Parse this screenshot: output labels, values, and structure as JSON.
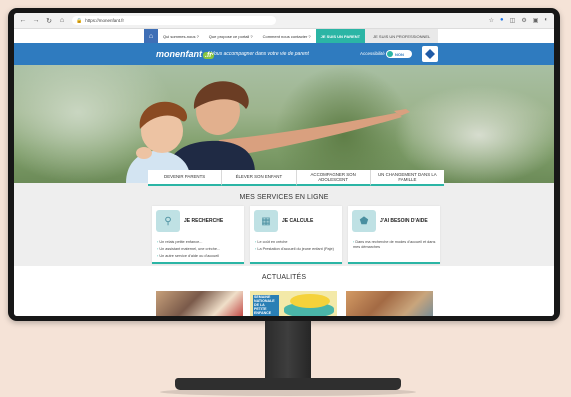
{
  "browser": {
    "url": "https://monenfant.fr"
  },
  "topnav": {
    "links": [
      "Qui sommes-nous ?",
      "Que propose ce portail ?",
      "Comment nous contacter ?"
    ],
    "parent_label": "JE SUIS UN PARENT",
    "pro_label": "JE SUIS UN PROFESSIONNEL"
  },
  "header": {
    "logo_main": "monenfant",
    "logo_suffix": ".fr",
    "tagline": "Vous accompagner dans votre vie de parent",
    "accessibility_label": "Accessibilité",
    "accessibility_toggle": "NON"
  },
  "hero_tabs": [
    "DEVENIR PARENTS",
    "ÉLEVER SON ENFANT",
    "ACCOMPAGNER SON ADOLESCENT",
    "UN CHANGEMENT DANS LA FAMILLE"
  ],
  "services": {
    "title": "MES SERVICES EN LIGNE",
    "cards": [
      {
        "title": "JE RECHERCHE",
        "items": [
          "Un relais petite enfance...",
          "Un assistant maternel, une crèche...",
          "Un autre service d'aide ou d'accueil"
        ]
      },
      {
        "title": "JE CALCULE",
        "items": [
          "Le coût en crèche",
          "La Prestation d'accueil du jeune enfant (Paje)"
        ]
      },
      {
        "title": "J'AI BESOIN D'AIDE",
        "items": [
          "Dans ma recherche de modes d'accueil et dans mes démarches"
        ]
      }
    ]
  },
  "news": {
    "title": "ACTUALITÉS",
    "card2_text": "SEMAINE NATIONALE DE LA PETITE ENFANCE"
  },
  "colors": {
    "brand_blue": "#2f7bbf",
    "accent_teal": "#2bb5a5",
    "bezel": "#171717",
    "background": "#f5e3d7"
  }
}
